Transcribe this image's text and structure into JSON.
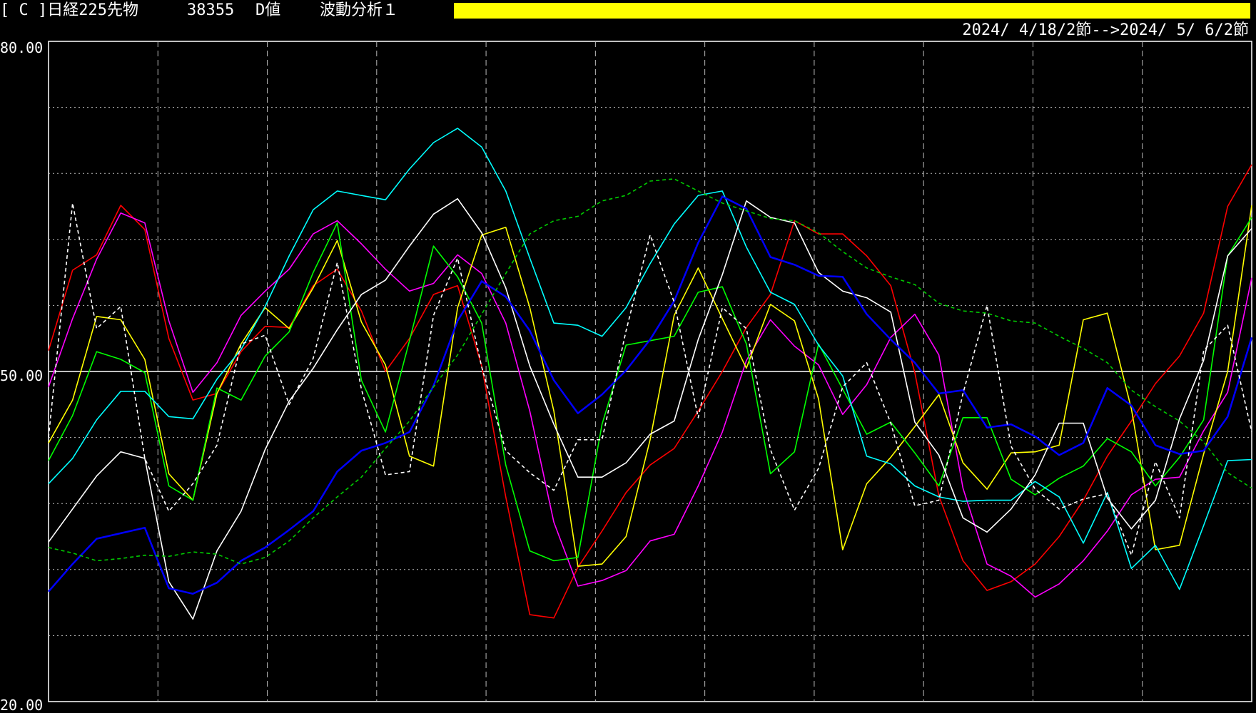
{
  "header": {
    "code": "[ C ]日経225先物",
    "price": "38355",
    "dval_label": "D値",
    "analysis_label": "波動分析１",
    "range": "2024/ 4/18/2節-->2024/ 5/ 6/2節",
    "bar_color": "#ffff00"
  },
  "chart_data": {
    "type": "line",
    "title": "",
    "xlabel": "",
    "ylabel": "",
    "ylim": [
      20,
      80
    ],
    "yticks": [
      "80.00",
      "50.00",
      "20.00"
    ],
    "grid": true,
    "reference_line": 50,
    "x": [
      0,
      1,
      2,
      3,
      4,
      5,
      6,
      7,
      8,
      9,
      10,
      11,
      12,
      13,
      14,
      15,
      16,
      17,
      18,
      19,
      20,
      21,
      22,
      23,
      24,
      25,
      26,
      27,
      28,
      29,
      30,
      31,
      32,
      33,
      34,
      35,
      36,
      37,
      38,
      39,
      40,
      41,
      42,
      43,
      44,
      45,
      46,
      47,
      48,
      49,
      50
    ],
    "series": [
      {
        "color": "#ff0000",
        "style": "solid",
        "values": [
          51.9,
          59.2,
          60.6,
          65.1,
          62.9,
          53.0,
          47.4,
          48.0,
          51.8,
          54.1,
          54.0,
          57.8,
          59.3,
          55.5,
          50.0,
          53.0,
          57.0,
          57.8,
          50.5,
          38.6,
          27.9,
          27.6,
          32.2,
          35.5,
          39.0,
          41.5,
          43.0,
          46.4,
          50.0,
          54.0,
          57.0,
          63.7,
          62.5,
          62.5,
          60.5,
          57.8,
          49.9,
          38.7,
          32.8,
          30.1,
          30.9,
          32.5,
          35.0,
          38.3,
          42.3,
          45.5,
          48.9,
          51.4,
          55.3,
          65.0,
          68.8
        ]
      },
      {
        "color": "#ff00ff",
        "style": "solid",
        "values": [
          48.6,
          54.8,
          60.2,
          64.4,
          63.5,
          54.6,
          48.1,
          50.8,
          55.1,
          57.3,
          59.3,
          62.5,
          63.7,
          61.6,
          59.3,
          57.3,
          58.0,
          60.6,
          58.9,
          54.4,
          46.4,
          36.3,
          30.5,
          31.0,
          31.9,
          34.6,
          35.2,
          39.6,
          44.5,
          51.0,
          54.7,
          52.3,
          50.6,
          46.1,
          48.8,
          53.1,
          55.2,
          51.5,
          39.4,
          32.5,
          31.4,
          29.5,
          30.7,
          32.8,
          35.5,
          38.8,
          40.2,
          40.4,
          44.6,
          48.1,
          58.5
        ]
      },
      {
        "color": "#ffff00",
        "style": "solid",
        "values": [
          43.5,
          47.4,
          55.0,
          54.7,
          51.1,
          40.7,
          38.3,
          48.0,
          52.5,
          55.8,
          53.9,
          57.6,
          61.9,
          54.5,
          50.6,
          42.3,
          41.4,
          55.8,
          62.4,
          63.1,
          55.8,
          46.4,
          32.3,
          32.5,
          35.0,
          43.8,
          55.1,
          59.4,
          54.8,
          50.3,
          56.1,
          54.6,
          47.5,
          33.8,
          39.8,
          42.2,
          45.0,
          47.9,
          41.7,
          39.3,
          42.6,
          42.7,
          43.3,
          54.7,
          55.3,
          46.6,
          33.8,
          34.2,
          42.5,
          50.0,
          65.1
        ]
      },
      {
        "color": "#00ff00",
        "style": "solid",
        "values": [
          41.9,
          46.0,
          51.8,
          51.1,
          49.9,
          39.6,
          38.3,
          48.5,
          47.4,
          51.4,
          53.6,
          59.0,
          63.5,
          49.2,
          44.5,
          52.8,
          61.4,
          58.6,
          54.4,
          41.5,
          33.7,
          32.8,
          33.1,
          45.2,
          52.4,
          52.8,
          53.2,
          57.2,
          57.7,
          52.5,
          40.7,
          42.7,
          52.5,
          48.4,
          44.3,
          45.4,
          42.6,
          39.6,
          45.8,
          45.8,
          40.2,
          38.8,
          40.3,
          41.4,
          43.9,
          42.7,
          39.6,
          42.2,
          45.6,
          60.5,
          64.0
        ]
      },
      {
        "color": "#00ffff",
        "style": "solid",
        "values": [
          39.8,
          42.1,
          45.6,
          48.2,
          48.2,
          45.9,
          45.7,
          49.3,
          52.0,
          55.9,
          60.5,
          64.7,
          66.4,
          66.0,
          65.6,
          68.4,
          70.8,
          72.1,
          70.4,
          66.4,
          60.3,
          54.4,
          54.2,
          53.2,
          55.8,
          59.8,
          63.4,
          66.0,
          66.4,
          61.3,
          57.2,
          56.1,
          52.4,
          49.6,
          42.3,
          41.6,
          39.6,
          38.6,
          38.2,
          38.3,
          38.3,
          40.0,
          38.6,
          34.4,
          39.0,
          32.1,
          34.2,
          30.2,
          36.0,
          41.9,
          42.0
        ]
      },
      {
        "color": "#ffffff",
        "style": "solid",
        "values": [
          34.5,
          37.5,
          40.5,
          42.7,
          42.1,
          30.9,
          27.5,
          33.7,
          37.3,
          42.9,
          47.3,
          50.3,
          53.8,
          57.0,
          58.3,
          61.4,
          64.3,
          65.7,
          62.6,
          57.6,
          50.5,
          45.2,
          40.4,
          40.4,
          41.7,
          44.3,
          45.5,
          52.9,
          58.8,
          65.5,
          64.0,
          63.5,
          59.0,
          57.3,
          56.7,
          55.4,
          45.4,
          42.4,
          36.7,
          35.4,
          37.5,
          40.6,
          45.3,
          45.3,
          38.5,
          35.7,
          38.3,
          45.7,
          51.0,
          60.5,
          63.0
        ]
      },
      {
        "color": "#0000ff",
        "style": "solid",
        "values": [
          30.0,
          32.5,
          34.8,
          35.3,
          35.8,
          30.3,
          29.8,
          30.8,
          32.8,
          34.0,
          35.6,
          37.3,
          40.9,
          42.8,
          43.5,
          44.5,
          48.7,
          54.6,
          58.2,
          56.8,
          53.7,
          49.2,
          46.2,
          47.9,
          50.1,
          52.9,
          56.4,
          61.7,
          65.9,
          64.8,
          60.4,
          59.7,
          58.7,
          58.6,
          55.2,
          52.9,
          50.8,
          48.0,
          48.3,
          44.9,
          45.2,
          44.1,
          42.4,
          43.5,
          48.5,
          46.9,
          43.3,
          42.5,
          42.8,
          45.9,
          53.1
        ]
      },
      {
        "color": "#ffffff",
        "style": "dashed",
        "values": [
          44.0,
          65.3,
          53.9,
          55.9,
          42.1,
          37.3,
          39.8,
          43.3,
          52.5,
          53.3,
          47.0,
          51.2,
          59.9,
          48.4,
          40.6,
          40.9,
          55.1,
          60.3,
          50.4,
          42.8,
          40.8,
          39.2,
          43.8,
          43.8,
          53.7,
          62.4,
          56.3,
          45.8,
          55.8,
          53.9,
          42.9,
          37.4,
          41.2,
          48.6,
          50.8,
          45.3,
          37.8,
          38.3,
          48.0,
          56.0,
          43.2,
          39.3,
          37.5,
          38.4,
          38.9,
          33.3,
          41.8,
          36.7,
          51.9,
          54.2,
          44.5
        ]
      },
      {
        "color": "#00cc00",
        "style": "dashed",
        "values": [
          34.0,
          33.5,
          32.8,
          33.0,
          33.3,
          33.2,
          33.6,
          33.4,
          32.5,
          33.1,
          34.6,
          36.7,
          38.6,
          40.4,
          43.0,
          45.5,
          48.6,
          51.5,
          55.2,
          58.9,
          62.5,
          63.7,
          64.1,
          65.5,
          66.0,
          67.3,
          67.5,
          66.4,
          65.3,
          64.6,
          63.9,
          63.7,
          62.6,
          60.9,
          59.4,
          58.6,
          57.9,
          56.2,
          55.5,
          55.3,
          54.6,
          54.4,
          53.2,
          52.1,
          50.8,
          48.3,
          46.8,
          45.5,
          43.6,
          40.8,
          39.4
        ]
      }
    ]
  }
}
